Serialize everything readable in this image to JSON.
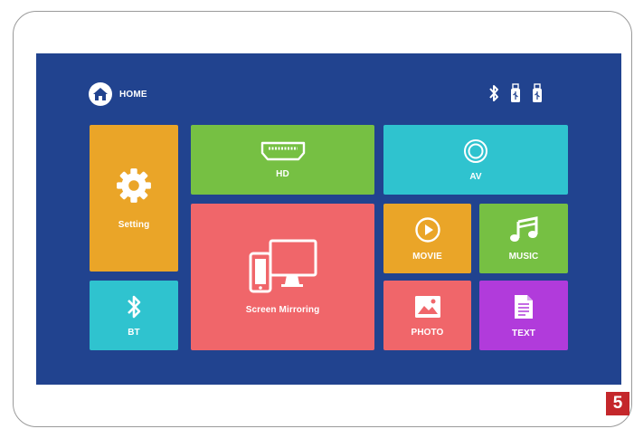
{
  "header": {
    "home_label": "HOME",
    "home_icon": "home-icon"
  },
  "status_icons": [
    "bluetooth-icon",
    "usb-drive-icon",
    "usb-drive-icon"
  ],
  "tiles": {
    "setting": {
      "label": "Setting",
      "icon": "gear-icon",
      "color": "#eaa528"
    },
    "hd": {
      "label": "HD",
      "icon": "hdmi-icon",
      "color": "#76c043"
    },
    "av": {
      "label": "AV",
      "icon": "av-icon",
      "color": "#2fc3cf"
    },
    "screen_mirroring": {
      "label": "Screen Mirroring",
      "icon": "devices-icon",
      "color": "#f0666a"
    },
    "movie": {
      "label": "MOVIE",
      "icon": "play-icon",
      "color": "#eaa528"
    },
    "music": {
      "label": "MUSIC",
      "icon": "music-icon",
      "color": "#76c043"
    },
    "bt": {
      "label": "BT",
      "icon": "bluetooth-icon",
      "color": "#2fc3cf"
    },
    "photo": {
      "label": "PHOTO",
      "icon": "image-icon",
      "color": "#f0666a"
    },
    "text": {
      "label": "TEXT",
      "icon": "document-icon",
      "color": "#b13bdb"
    }
  },
  "page_badge": "5",
  "colors": {
    "screen_bg": "#21438f",
    "badge": "#c4272b"
  }
}
